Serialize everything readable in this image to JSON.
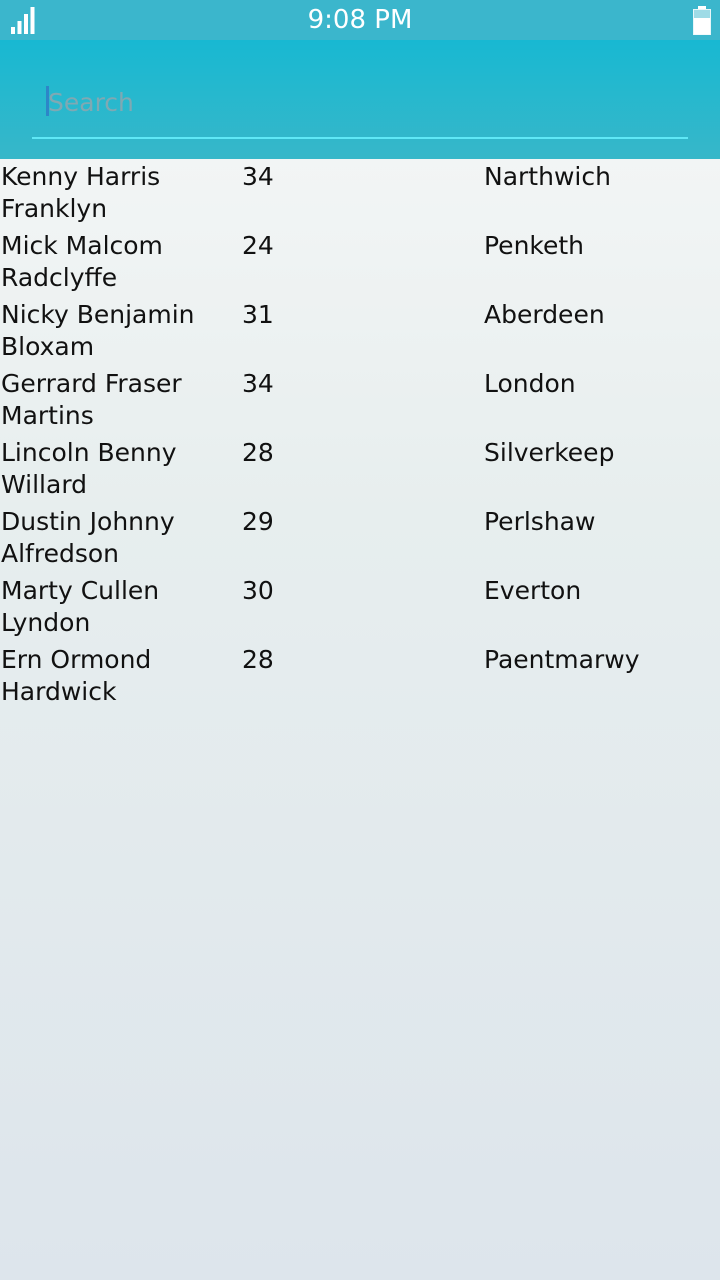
{
  "status_bar": {
    "time": "9:08 PM",
    "signal_icon": "signal-bars-icon",
    "battery_icon": "battery-icon"
  },
  "search": {
    "placeholder": "Search",
    "value": ""
  },
  "colors": {
    "status_bar_bg": "#3bb6cc",
    "header_bg": "#18b8d2",
    "search_underline": "#5fe8f6",
    "cursor": "#2d86c8"
  },
  "people": [
    {
      "name": "Kenny Harris Franklyn",
      "age": "34",
      "city": "Narthwich"
    },
    {
      "name": "Mick Malcom Radclyffe",
      "age": "24",
      "city": "Penketh"
    },
    {
      "name": "Nicky Benjamin Bloxam",
      "age": "31",
      "city": "Aberdeen"
    },
    {
      "name": "Gerrard Fraser Martins",
      "age": "34",
      "city": "London"
    },
    {
      "name": "Lincoln Benny Willard",
      "age": "28",
      "city": "Silverkeep"
    },
    {
      "name": "Dustin Johnny Alfredson",
      "age": "29",
      "city": "Perlshaw"
    },
    {
      "name": "Marty Cullen Lyndon",
      "age": "30",
      "city": "Everton"
    },
    {
      "name": "Ern Ormond Hardwick",
      "age": "28",
      "city": "Paentmarwy"
    }
  ]
}
